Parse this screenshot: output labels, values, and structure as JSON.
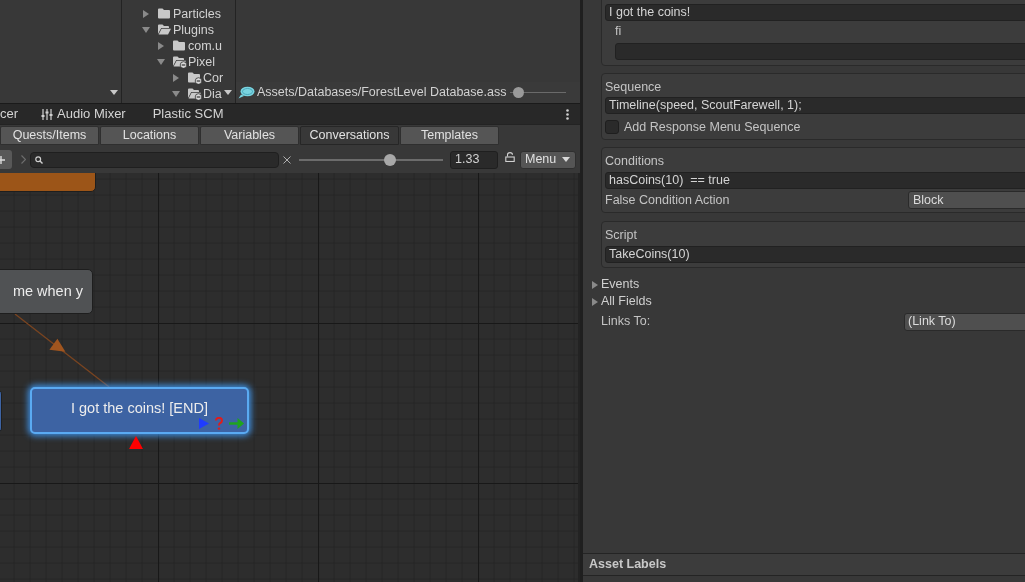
{
  "project": {
    "tree": [
      {
        "label": "Particles",
        "kind": "folder",
        "expanded": false
      },
      {
        "label": "Plugins",
        "kind": "folder",
        "expanded": true,
        "children": [
          {
            "label": "com.u",
            "kind": "folder",
            "expanded": false
          },
          {
            "label": "Pixel",
            "kind": "package",
            "expanded": true,
            "children": [
              {
                "label": "Cor",
                "kind": "package",
                "expanded": false
              },
              {
                "label": "Dia",
                "kind": "package",
                "expanded": true
              }
            ]
          }
        ]
      }
    ],
    "asset_path": "Assets/Databases/ForestLevel Database.ass",
    "icon_size": {
      "level": 0.05
    }
  },
  "window_tabs": [
    {
      "label": "cer",
      "kind": "plain",
      "selected": false
    },
    {
      "label": "Audio Mixer",
      "kind": "mixer",
      "selected": false
    },
    {
      "label": "Plastic SCM",
      "kind": "plain",
      "selected": false
    }
  ],
  "database_tabs": [
    {
      "label": "Quests/Items",
      "selected": false
    },
    {
      "label": "Locations",
      "selected": false
    },
    {
      "label": "Variables",
      "selected": false
    },
    {
      "label": "Conversations",
      "selected": true
    },
    {
      "label": "Templates",
      "selected": false
    }
  ],
  "toolbar": {
    "zoom": {
      "level": 0.63,
      "value": "1.33"
    },
    "menu": "Menu"
  },
  "canvas": {
    "nodes": [
      {
        "color": "#9c5518",
        "selected": false
      },
      {
        "text": "me when y",
        "color": "#505254",
        "selected": false
      },
      {
        "color": "#3d63a3",
        "selected": false
      },
      {
        "text": "I got the coins! [END]",
        "color": "#3d63a3",
        "selected": true,
        "has_sequence": true,
        "has_conditions": true,
        "has_script": true
      }
    ]
  },
  "inspector": {
    "dialogue_text": {
      "value": "I got the coins!",
      "sub_label": "fi"
    },
    "sequence": {
      "title": "Sequence",
      "value": "Timeline(speed, ScoutFarewell, 1);",
      "option": {
        "label": "Add Response Menu Sequence",
        "checked": false
      }
    },
    "conditions": {
      "title": "Conditions",
      "value": "hasCoins(10)  == true",
      "false_action": {
        "label": "False Condition Action",
        "value": "Block"
      }
    },
    "script": {
      "title": "Script",
      "value": "TakeCoins(10)"
    },
    "foldouts": [
      {
        "label": "Events",
        "expanded": false
      },
      {
        "label": "All Fields",
        "expanded": false
      }
    ],
    "links_to": {
      "label": "Links To:",
      "value": "(Link To)"
    }
  },
  "asset_labels": {
    "title": "Asset Labels"
  }
}
